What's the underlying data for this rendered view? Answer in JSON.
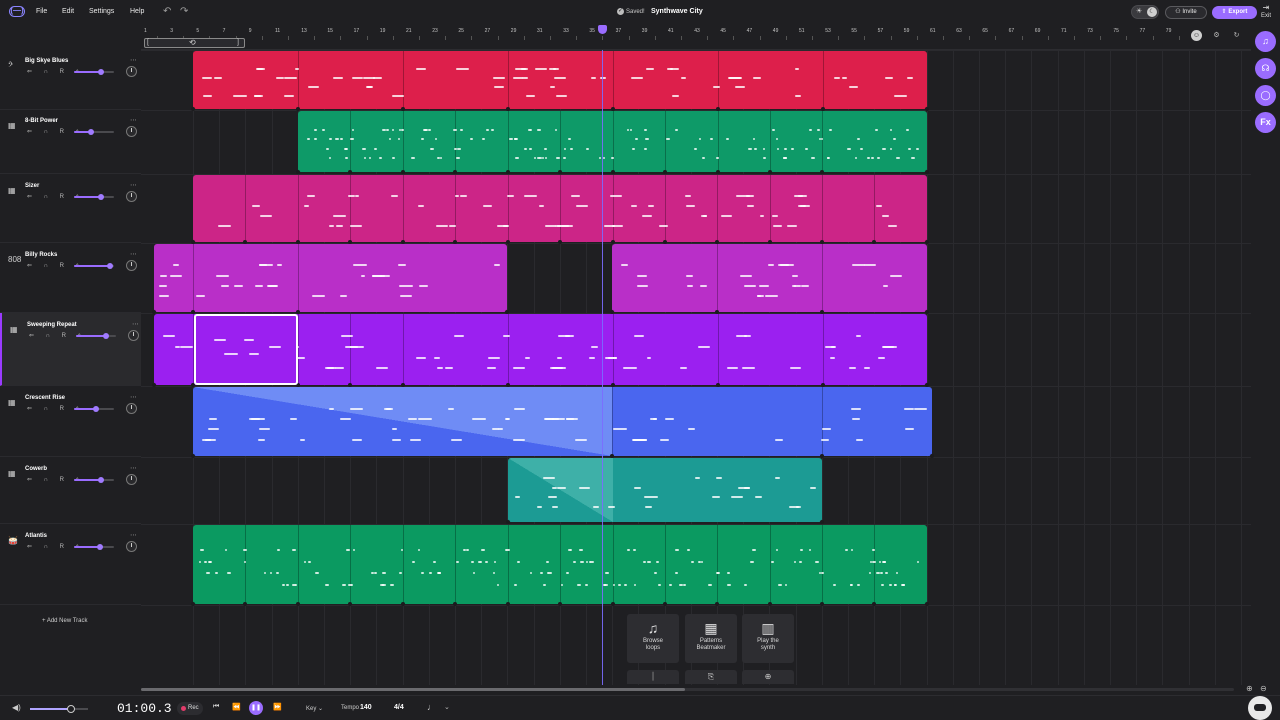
{
  "menu": {
    "logo": "(—)",
    "items": [
      "File",
      "Edit",
      "Settings",
      "Help"
    ],
    "undo": "↶",
    "redo": "↷"
  },
  "project": {
    "saved": "Saved!",
    "title": "Synthwave City"
  },
  "header_actions": {
    "invite": "Invite",
    "export": "Export",
    "exit": "Exit"
  },
  "ruler": {
    "labels": [
      "1",
      "3",
      "5",
      "7",
      "9",
      "11",
      "13",
      "15",
      "17",
      "19",
      "21",
      "23",
      "25",
      "27",
      "29",
      "31",
      "33",
      "35",
      "37",
      "39",
      "41",
      "43",
      "45",
      "47",
      "49",
      "51",
      "53",
      "55",
      "57",
      "59",
      "61",
      "63",
      "65",
      "67",
      "69",
      "71",
      "73",
      "75",
      "77",
      "79"
    ]
  },
  "tracks": [
    {
      "name": "Big Skye Blues",
      "icon": "guitar-icon",
      "glyph": "𝄢",
      "volume": 0.68
    },
    {
      "name": "8-Bit Power",
      "icon": "keyboard-icon",
      "glyph": "▦",
      "volume": 0.42
    },
    {
      "name": "Sizer",
      "icon": "keyboard-icon",
      "glyph": "▦",
      "volume": 0.68
    },
    {
      "name": "Billy Rocks",
      "icon": "drum-machine-icon",
      "glyph": "808",
      "volume": 0.9
    },
    {
      "name": "Sweeping Repeat",
      "icon": "keyboard-icon",
      "glyph": "▦",
      "volume": 0.75
    },
    {
      "name": "Crescent Rise",
      "icon": "keyboard-icon",
      "glyph": "▦",
      "volume": 0.55
    },
    {
      "name": "Cowerb",
      "icon": "keyboard-icon",
      "glyph": "▦",
      "volume": 0.68
    },
    {
      "name": "Atlantis",
      "icon": "drum-icon",
      "glyph": "🥁",
      "volume": 0.65
    }
  ],
  "track_controls": "⇐ ∩ R ∿",
  "add_track": "+ Add New Track",
  "clip_colors": {
    "big_skye_blues": "#dd1f4b",
    "eight_bit_power": "#0e9a68",
    "sizer": "#cc2587",
    "billy_rocks": "#b92fc8",
    "sweeping_repeat": "#9b20f0",
    "crescent_rise": "#4a66ef",
    "cowerb": "#1c9b94",
    "atlantis": "#0b9a61"
  },
  "tools": [
    {
      "icon": "music-note-icon",
      "glyph": "♫",
      "label": "Browse\nloops"
    },
    {
      "icon": "grid-icon",
      "glyph": "▦",
      "label": "Patterns\nBeatmaker"
    },
    {
      "icon": "piano-icon",
      "glyph": "▥",
      "label": "Play the\nsynth"
    }
  ],
  "sidebar_buttons": [
    {
      "icon": "music-note-icon",
      "glyph": "♫"
    },
    {
      "icon": "collab-icon",
      "glyph": "☊"
    },
    {
      "icon": "chat-icon",
      "glyph": "◯"
    },
    {
      "icon": "fx-icon",
      "glyph": "Fx"
    }
  ],
  "transport": {
    "time": "01:00.3",
    "rec": "Rec",
    "key_label": "Key ⌄",
    "tempo_label": "Tempo",
    "tempo_value": "140",
    "time_signature": "4/4",
    "master_volume": 0.7
  },
  "accent": "#9a6cff"
}
